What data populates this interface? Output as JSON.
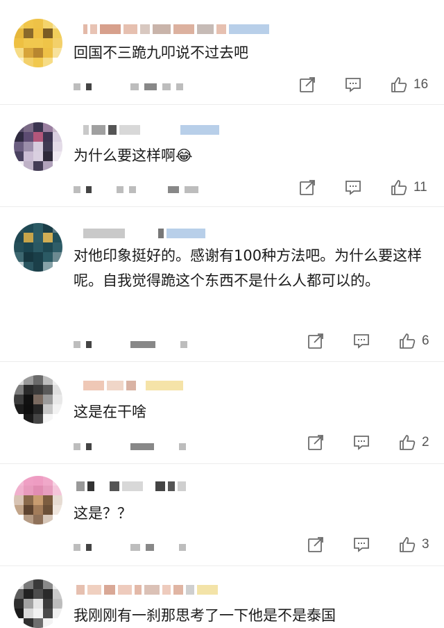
{
  "comments": [
    {
      "text": "回国不三跪九叩说不过去吧",
      "likes": "16"
    },
    {
      "text": "为什么要这样啊😂",
      "likes": "11"
    },
    {
      "text": "对他印象挺好的。感谢有100种方法吧。为什么要这样呢。自我觉得跪这个东西不是什么人都可以的。",
      "likes": "6"
    },
    {
      "text": "这是在干啥",
      "likes": "2"
    },
    {
      "text": "这是？？",
      "likes": "3"
    },
    {
      "text": "我刚刚有一刹那思考了一下他是不是泰国",
      "likes": ""
    }
  ],
  "icons": {
    "share": "share-icon",
    "reply": "comment-icon",
    "like": "thumbs-up-icon"
  },
  "colors": {
    "icon": "#6b6b6b",
    "divider": "#ececec",
    "text": "#1a1a1a"
  }
}
